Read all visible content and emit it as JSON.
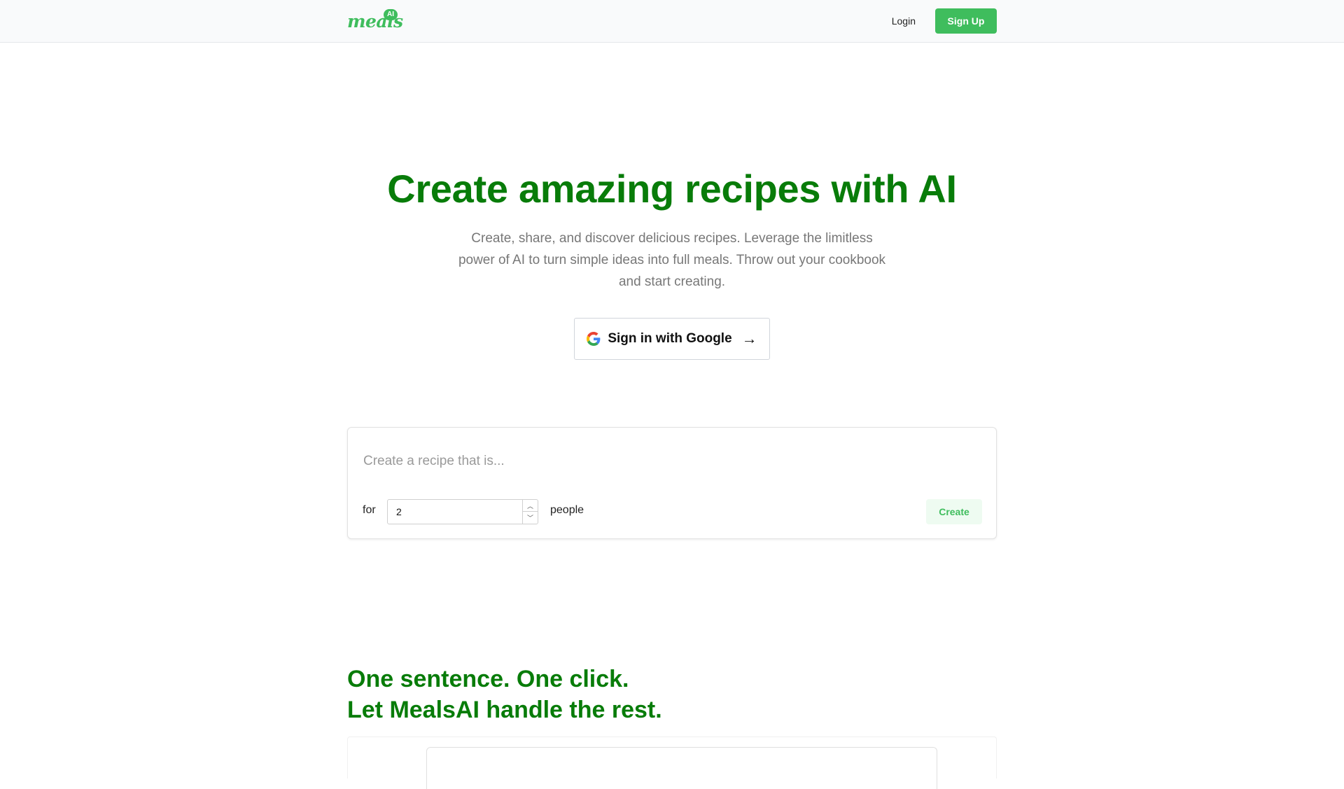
{
  "nav": {
    "logo_text": "meals",
    "logo_badge": "AI",
    "login_label": "Login",
    "signup_label": "Sign Up"
  },
  "hero": {
    "title": "Create amazing recipes with AI",
    "subtitle": "Create, share, and discover delicious recipes. Leverage the limitless power of AI to turn simple ideas into full meals. Throw out your cookbook and start creating.",
    "google_button_label": "Sign in with Google"
  },
  "recipe": {
    "placeholder": "Create a recipe that is...",
    "for_label": "for",
    "servings_value": "2",
    "people_label": "people",
    "create_label": "Create"
  },
  "feature": {
    "line1": "One sentence. One click.",
    "line2": "Let MealsAI handle the rest."
  },
  "colors": {
    "brand_green": "#3fbd5d",
    "heading_green": "#087c09",
    "create_bg": "#eefbf1"
  },
  "icons": {
    "google": "google-icon",
    "arrow": "arrow-right-icon",
    "step_up": "chevron-up-icon",
    "step_down": "chevron-down-icon"
  }
}
